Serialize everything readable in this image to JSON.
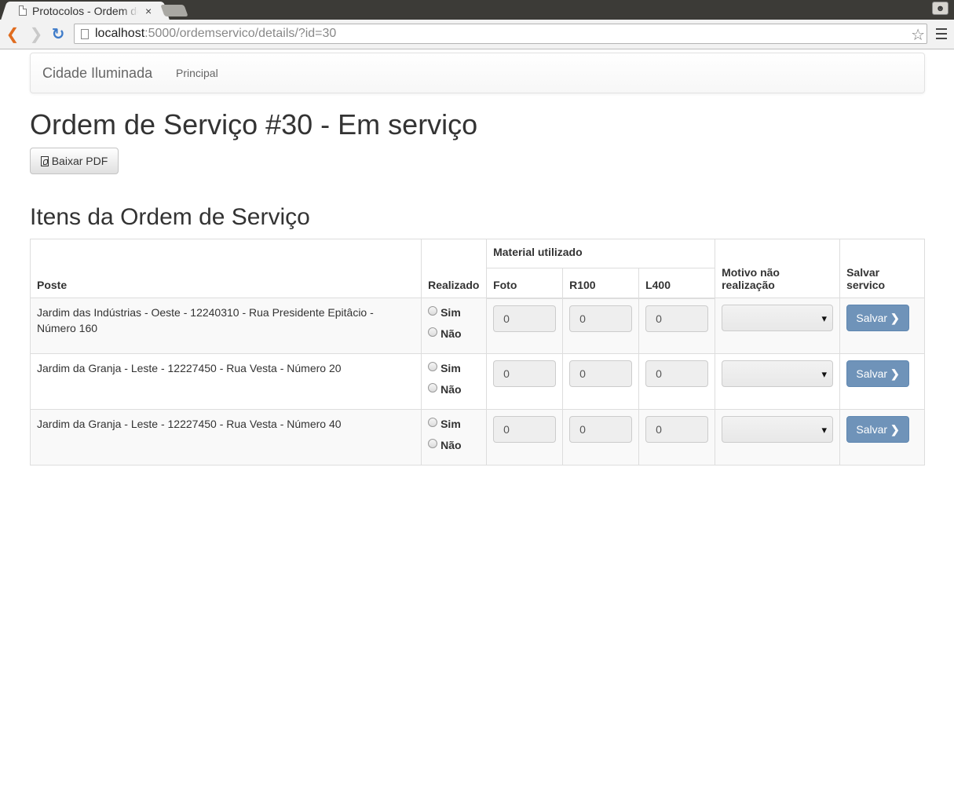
{
  "browser": {
    "tab_title": "Protocolos - Ordem de Serviço",
    "tab_close": "×",
    "url_host": "localhost",
    "url_rest": ":5000/ordemservico/details/?id=30"
  },
  "navbar": {
    "brand": "Cidade Iluminada",
    "links": [
      "Principal"
    ]
  },
  "page": {
    "title": "Ordem de Serviço #30 - Em serviço",
    "pdf_button": "Baixar PDF",
    "section_title": "Itens da Ordem de Serviço"
  },
  "table": {
    "headers": {
      "poste": "Poste",
      "realizado": "Realizado",
      "material": "Material utilizado",
      "foto": "Foto",
      "r100": "R100",
      "l400": "L400",
      "motivo": "Motivo não realização",
      "salvar": "Salvar servico"
    },
    "radio_labels": {
      "sim": "Sim",
      "nao": "Não"
    },
    "save_label": "Salvar",
    "rows": [
      {
        "poste": "Jardim das Indústrias - Oeste - 12240310 - Rua Presidente Epitâcio - Número 160",
        "foto": "0",
        "r100": "0",
        "l400": "0",
        "motivo": ""
      },
      {
        "poste": "Jardim da Granja - Leste - 12227450 - Rua Vesta - Número 20",
        "foto": "0",
        "r100": "0",
        "l400": "0",
        "motivo": ""
      },
      {
        "poste": "Jardim da Granja - Leste - 12227450 - Rua Vesta - Número 40",
        "foto": "0",
        "r100": "0",
        "l400": "0",
        "motivo": ""
      }
    ]
  },
  "icons": {
    "back": "back-arrow-icon",
    "forward": "forward-arrow-icon",
    "reload": "reload-icon",
    "star": "bookmark-star-icon",
    "menu": "menu-icon",
    "pdf": "pdf-file-icon",
    "chevron": "chevron-right-icon"
  },
  "colors": {
    "save_button": "#6f93b9",
    "back_arrow": "#e06c1f",
    "reload": "#3e7bc9"
  }
}
